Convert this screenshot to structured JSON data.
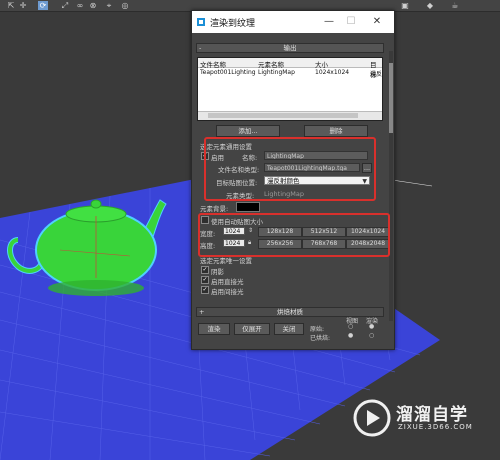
{
  "toolbar": {
    "icons": [
      "select-icon",
      "move-icon",
      "rotate-icon",
      "scale-icon",
      "link-icon",
      "unlink-icon",
      "bind-icon",
      "camera-icon",
      "render-icon",
      "material-icon"
    ]
  },
  "dialog": {
    "title": "渲染到纹理",
    "window_buttons": {
      "minimize": "—",
      "maximize": "☐",
      "close": "✕"
    },
    "output_section": "输出",
    "table": {
      "headers": [
        "文件名称",
        "元素名称",
        "大小",
        "目标"
      ],
      "row": [
        "Teapot001LightingM...",
        "LightingMap",
        "1024x1024",
        "漫反"
      ]
    },
    "add_button": "添加...",
    "delete_button": "删除",
    "selected_settings_header": "选定元素通用设置",
    "enable_label": "启用",
    "name_label": "名称:",
    "name_value": "LightingMap",
    "file_label": "文件名和类型:",
    "file_value": "Teapot001LightingMap.tga",
    "browse_button": "...",
    "target_slot_label": "目标贴图位置:",
    "target_slot_value": "漫反射颜色",
    "element_type_label": "元素类型:",
    "element_type_value": "LightingMap",
    "element_bg_label": "元素背景:",
    "auto_map_size_label": "使用自动贴图大小",
    "width_label": "宽度:",
    "width_value": "1024",
    "height_label": "高度:",
    "height_value": "1024",
    "size_buttons": [
      "128x128",
      "512x512",
      "1024x1024",
      "256x256",
      "768x768",
      "2048x2048"
    ],
    "unique_settings_header": "选定元素唯一设置",
    "shadows_label": "阴影",
    "direct_light_label": "启用直接光",
    "indirect_light_label": "启用间接光",
    "bake_material_section": "烘焙材质",
    "render_button": "渲染",
    "unwrap_button": "仅展开",
    "close_button": "关闭",
    "original_label": "原始:",
    "baked_label": "已烘焙:",
    "views_label": "视图",
    "render_label": "渲染"
  },
  "watermark": {
    "title": "溜溜自学",
    "url": "ZIXUE.3D66.COM"
  },
  "colors": {
    "teapot": "#39d43a",
    "grid": "#3a45d6",
    "highlight": "#d9302c"
  }
}
